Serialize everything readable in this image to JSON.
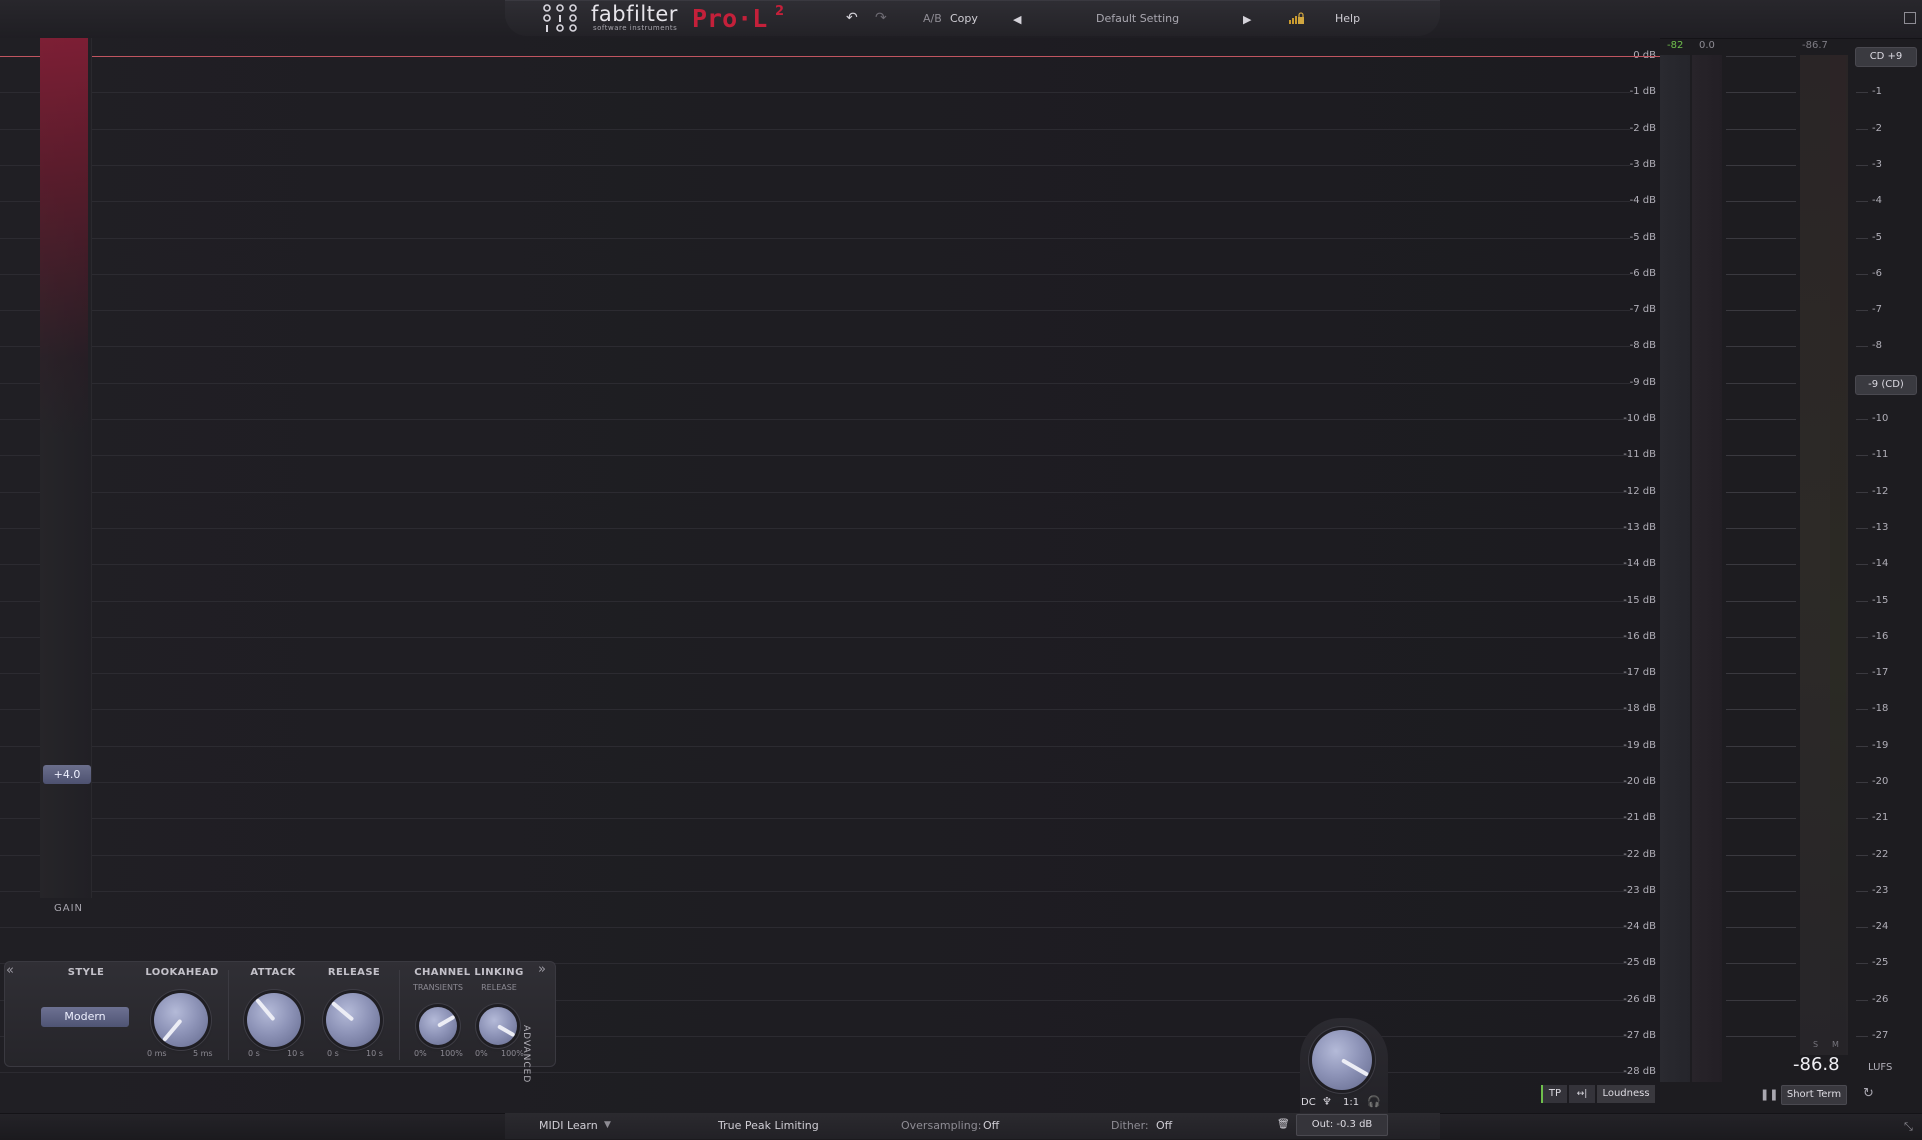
{
  "header": {
    "brand_name": "fabfilter",
    "brand_sub": "software instruments",
    "product": "Pro·L",
    "product_sup": "2",
    "undo_icon": "undo-icon",
    "redo_icon": "redo-icon",
    "ab_label": "A/B",
    "copy_label": "Copy",
    "preset_name": "Default Setting",
    "help_label": "Help"
  },
  "display": {
    "db_labels": [
      "0 dB",
      "-1 dB",
      "-2 dB",
      "-3 dB",
      "-4 dB",
      "-5 dB",
      "-6 dB",
      "-7 dB",
      "-8 dB",
      "-9 dB",
      "-10 dB",
      "-11 dB",
      "-12 dB",
      "-13 dB",
      "-14 dB",
      "-15 dB",
      "-16 dB",
      "-17 dB",
      "-18 dB",
      "-19 dB",
      "-20 dB",
      "-21 dB",
      "-22 dB",
      "-23 dB",
      "-24 dB",
      "-25 dB",
      "-26 dB",
      "-27 dB",
      "-28 dB"
    ],
    "gain_value": "+4.0",
    "gain_label": "GAIN"
  },
  "controls": {
    "style_title": "STYLE",
    "style_value": "Modern",
    "lookahead_title": "LOOKAHEAD",
    "lookahead_min": "0 ms",
    "lookahead_max": "5 ms",
    "attack_title": "ATTACK",
    "attack_min": "0 s",
    "attack_max": "10 s",
    "release_title": "RELEASE",
    "release_min": "0 s",
    "release_max": "10 s",
    "linking_title": "CHANNEL LINKING",
    "transients_sub": "TRANSIENTS",
    "release_sub": "RELEASE",
    "transients_min": "0%",
    "transients_max": "100%",
    "linkrel_min": "0%",
    "linkrel_max": "100%",
    "advanced_label": "ADVANCED"
  },
  "meters": {
    "peak_in_l": "-82",
    "peak_in_r": "0.0",
    "peak_out": "-86.7",
    "lufs_scale": [
      "CD +9",
      "-1",
      "-2",
      "-3",
      "-4",
      "-5",
      "-6",
      "-7",
      "-8",
      "-9 (CD)",
      "-10",
      "-11",
      "-12",
      "-13",
      "-14",
      "-15",
      "-16",
      "-17",
      "-18",
      "-19",
      "-20",
      "-21",
      "-22",
      "-23",
      "-24",
      "-25",
      "-26",
      "-27"
    ],
    "sm_s": "S",
    "sm_m": "M",
    "lufs_value": "-86.8",
    "lufs_unit": "LUFS",
    "short_term_label": "Short Term",
    "tp_label": "TP",
    "mode_label": "↔|",
    "loudness_label": "Loudness"
  },
  "output": {
    "dc_label": "DC",
    "ratio_label": "1:1",
    "out_level": "Out: -0.3 dB"
  },
  "bottombar": {
    "midi_learn": "MIDI Learn",
    "true_peak": "True Peak Limiting",
    "oversampling_label": "Oversampling:",
    "oversampling_value": "Off",
    "dither_label": "Dither:",
    "dither_value": "Off"
  },
  "colors": {
    "accent_red": "#c4203a",
    "knob_blue": "#8e94b8",
    "meter_green": "#6fbf4c"
  }
}
